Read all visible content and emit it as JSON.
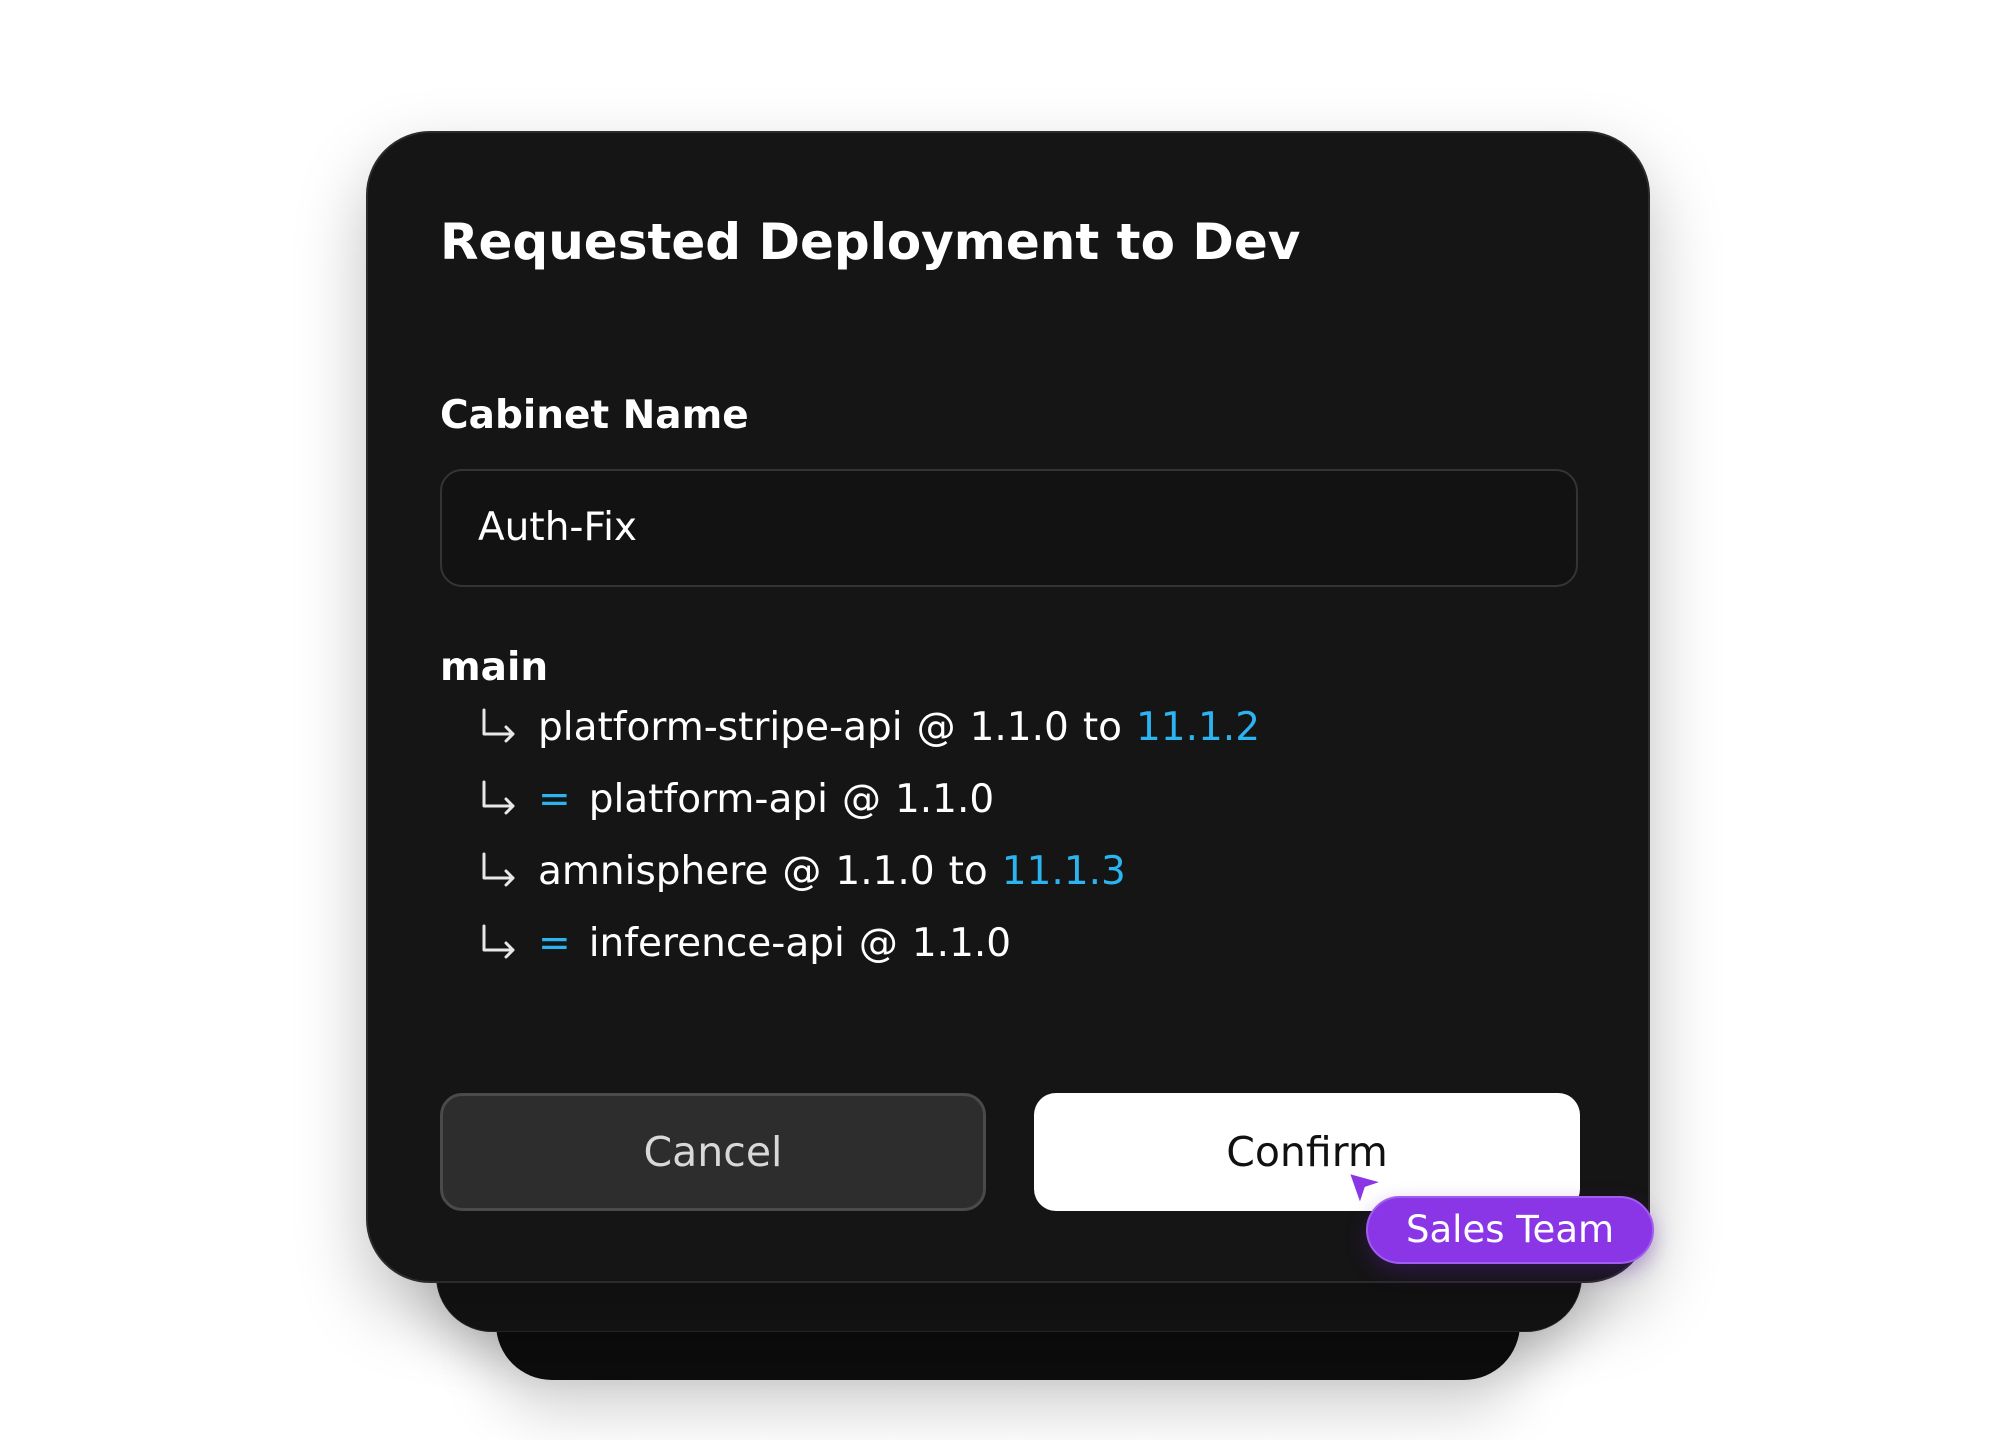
{
  "dialog": {
    "title": "Requested Deployment to Dev",
    "cabinet_name_label": "Cabinet Name",
    "cabinet_name_value": "Auth-Fix",
    "branch": "main",
    "services": [
      {
        "name": "platform-stripe-api",
        "at": "@",
        "current_version": "1.1.0",
        "to": "to",
        "new_version": "11.1.2"
      },
      {
        "marker": "=",
        "name": "platform-api",
        "at": "@",
        "current_version": "1.1.0"
      },
      {
        "name": "amnisphere",
        "at": "@",
        "current_version": "1.1.0",
        "to": "to",
        "new_version": "11.1.3"
      },
      {
        "marker": "=",
        "name": "inference-api",
        "at": "@",
        "current_version": "1.1.0"
      }
    ],
    "cancel_label": "Cancel",
    "confirm_label": "Confirm"
  },
  "cursor": {
    "label": "Sales Team",
    "color": "#8a35e6"
  },
  "colors": {
    "dialog_background": "#151515",
    "accent_blue": "#2bb4f0",
    "confirm_background": "#ffffff",
    "cancel_background": "#2d2d2d"
  },
  "icons": {
    "branch_entry": "arrow-down-right-icon",
    "cursor": "pointer-cursor-icon"
  }
}
